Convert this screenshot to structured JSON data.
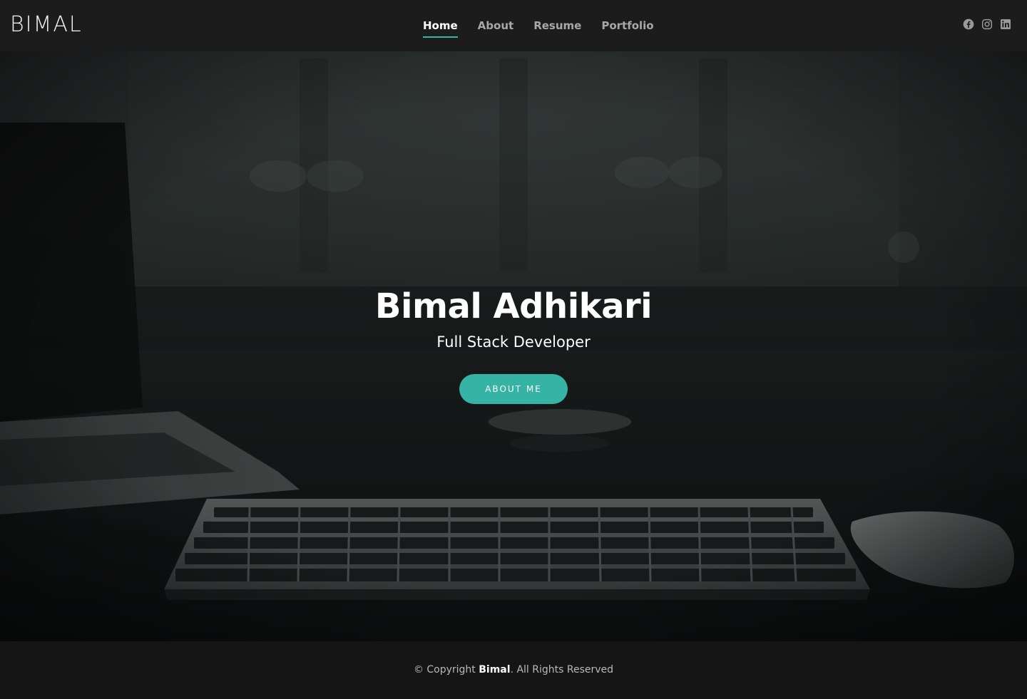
{
  "header": {
    "logo": "BIMAL",
    "nav": [
      {
        "label": "Home",
        "active": true
      },
      {
        "label": "About",
        "active": false
      },
      {
        "label": "Resume",
        "active": false
      },
      {
        "label": "Portfolio",
        "active": false
      }
    ],
    "social": [
      "facebook-icon",
      "instagram-icon",
      "linkedin-icon"
    ]
  },
  "hero": {
    "title": "Bimal Adhikari",
    "subtitle": "Full Stack Developer",
    "button_label": "ABOUT ME"
  },
  "footer": {
    "prefix": "© Copyright ",
    "name": "Bimal",
    "suffix": ". All Rights Reserved"
  },
  "colors": {
    "accent": "#35b3a4",
    "header_bg": "#1c1c1c",
    "footer_bg": "#151515"
  }
}
